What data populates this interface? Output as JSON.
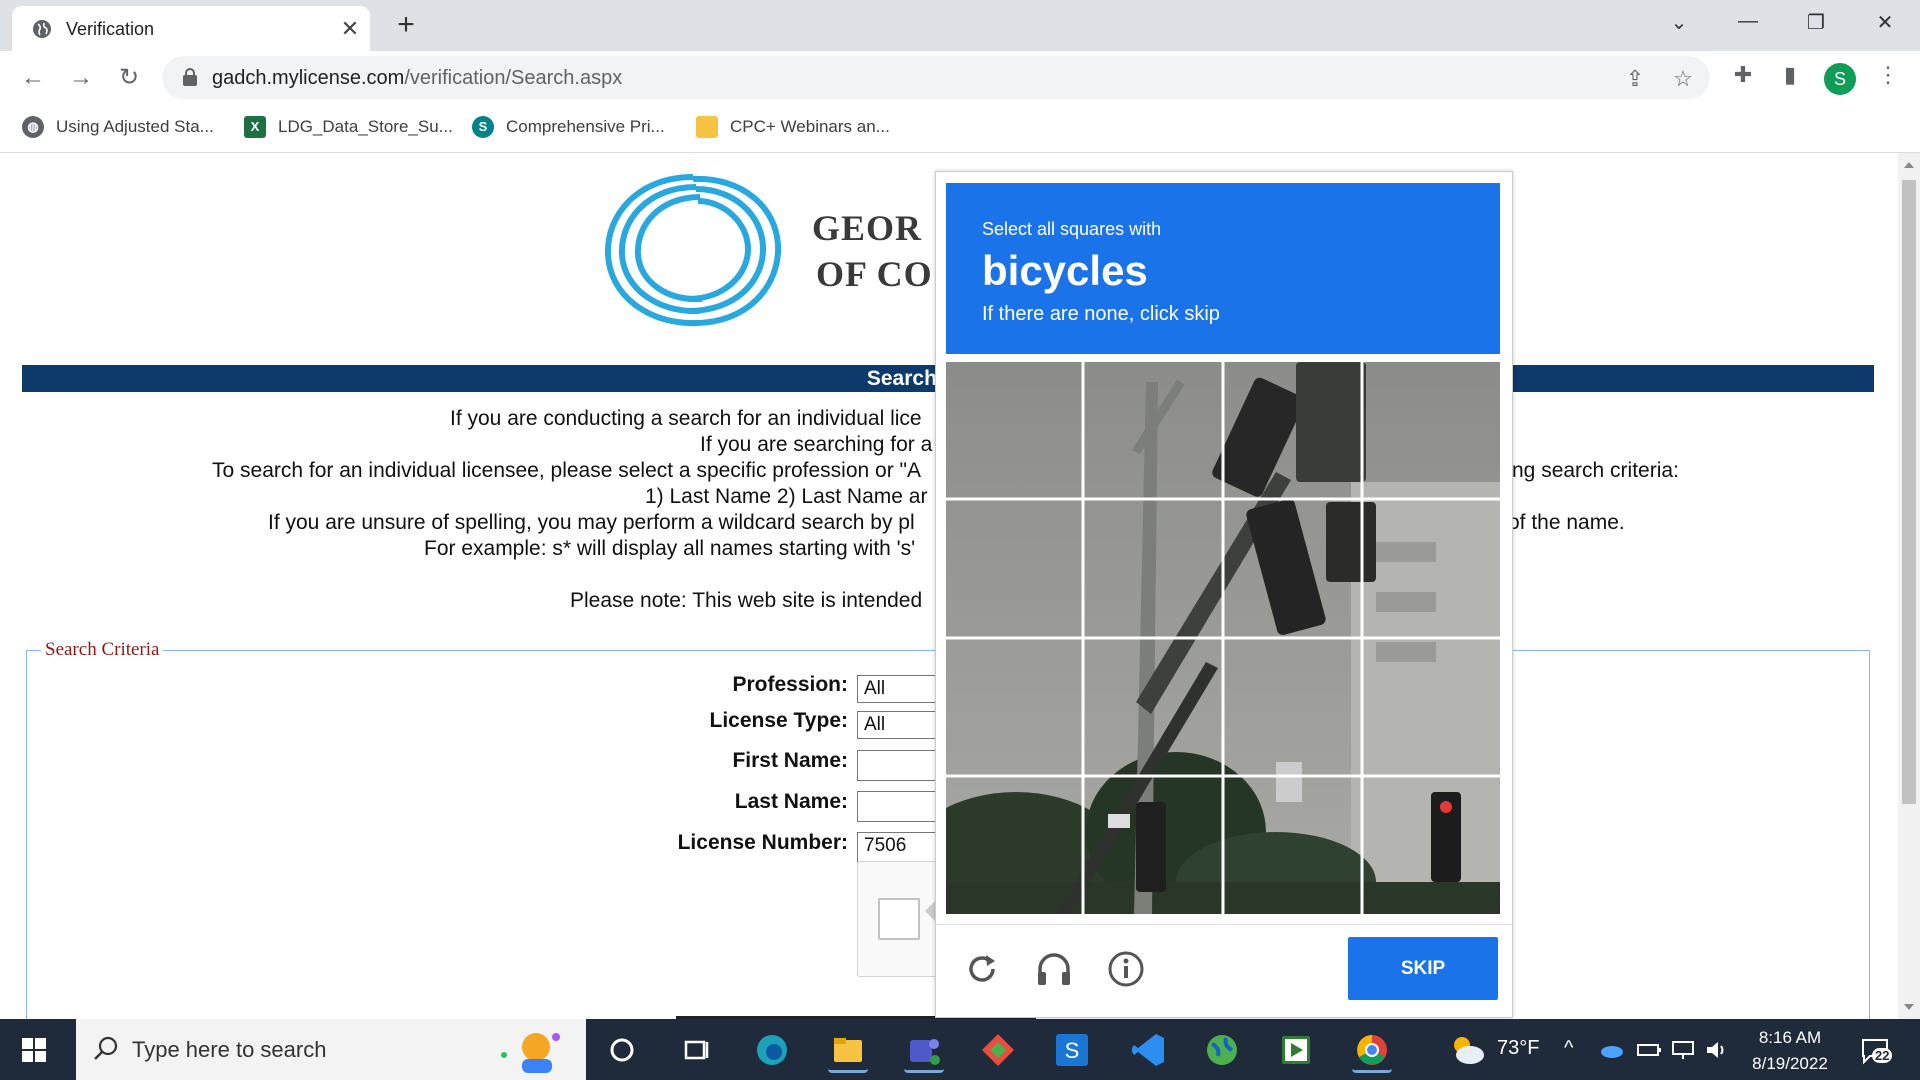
{
  "browser": {
    "tab_title": "Verification",
    "tab_close": "✕",
    "new_tab": "+",
    "url_host": "gadch.mylicense.com",
    "url_path": "/verification/Search.aspx",
    "profile_initial": "S",
    "window_controls": [
      "⌄",
      "—",
      "❐",
      "✕"
    ]
  },
  "bookmarks": [
    {
      "label": "Using Adjusted Sta...",
      "icon": "globe-icon",
      "color": "#5f6368"
    },
    {
      "label": "LDG_Data_Store_Su...",
      "icon": "excel-icon",
      "color": "#1d7044"
    },
    {
      "label": "Comprehensive Pri...",
      "icon": "sharepoint-icon",
      "color": "#038387"
    },
    {
      "label": "CPC+ Webinars an...",
      "icon": "folder-icon",
      "color": "#f6c343"
    }
  ],
  "page": {
    "org_name_line1": "GEOR",
    "org_name_line2": "OF CO",
    "banner": "Search for a Pro",
    "intro_lines": [
      "If you are conducting a search for an individual lice",
      "If you are searching for a",
      "To search for an individual licensee, please select a specific profession or \"A",
      "ng search criteria:",
      "1) Last Name 2) Last Name ar",
      "If you are unsure of spelling, you may perform a wildcard search by pl",
      "of the name.",
      "For example: s* will display all names starting with 's'",
      "Please note: This web site is intended"
    ],
    "criteria_legend": "Search Criteria",
    "fields": {
      "profession_label": "Profession:",
      "profession_value": "All",
      "license_type_label": "License Type:",
      "license_type_value": "All",
      "first_name_label": "First Name:",
      "first_name_value": "",
      "last_name_label": "Last Name:",
      "last_name_value": "",
      "license_number_label": "License Number:",
      "license_number_value": "7506"
    }
  },
  "captcha": {
    "prompt_small": "Select all squares with",
    "prompt_target": "bicycles",
    "prompt_hint": "If there are none, click skip",
    "skip_label": "SKIP",
    "grid_rows": 4,
    "grid_cols": 4,
    "header_color": "#1a73e8"
  },
  "taskbar": {
    "search_placeholder": "Type here to search",
    "weather": "73°F",
    "time": "8:16 AM",
    "date": "8/19/2022",
    "notification_count": "22",
    "tray_chevron": "^"
  }
}
